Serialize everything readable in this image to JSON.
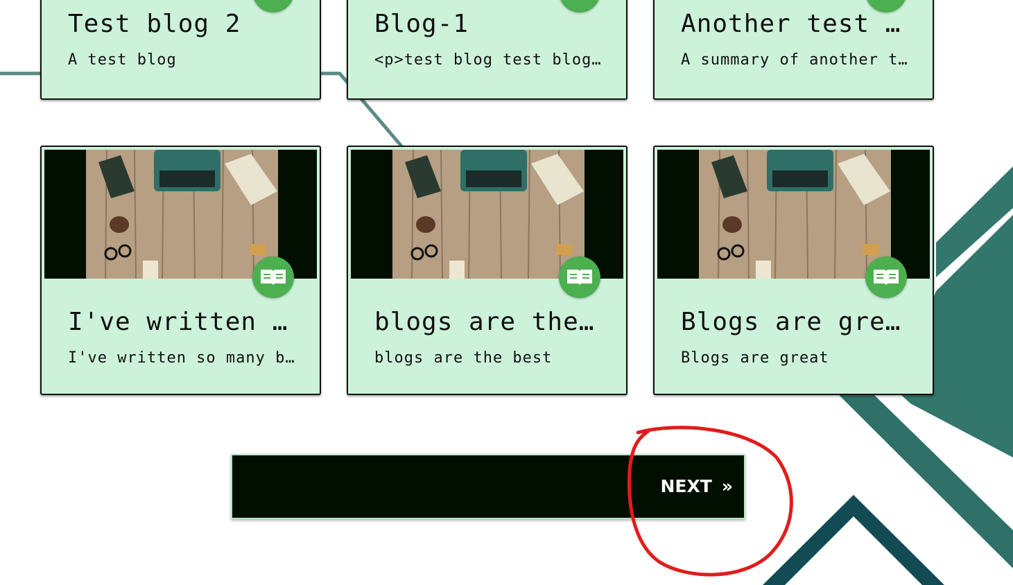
{
  "colors": {
    "card_bg": "#cdf2da",
    "badge": "#4caf50",
    "pager_bg": "#000f00",
    "accent_teal": "#33766c",
    "annotation_red": "#e21c1c"
  },
  "cards_top": [
    {
      "title": "Test blog 2",
      "summary": "A test blog",
      "badge_icon": "book-icon"
    },
    {
      "title": "Blog-1",
      "summary": "<p>test blog test blog test blog</p>",
      "badge_icon": "book-icon"
    },
    {
      "title": "Another test blog",
      "summary": "A summary of another test blog",
      "badge_icon": "book-icon"
    }
  ],
  "cards_bottom": [
    {
      "title": "I've written so many blogs",
      "summary": "I've written so many blogs",
      "badge_icon": "book-icon"
    },
    {
      "title": "blogs are the best",
      "summary": "blogs are the best",
      "badge_icon": "book-icon"
    },
    {
      "title": "Blogs are great",
      "summary": "Blogs are great",
      "badge_icon": "book-icon"
    }
  ],
  "pagination": {
    "next_label": "NEXT",
    "next_arrow": "»"
  }
}
